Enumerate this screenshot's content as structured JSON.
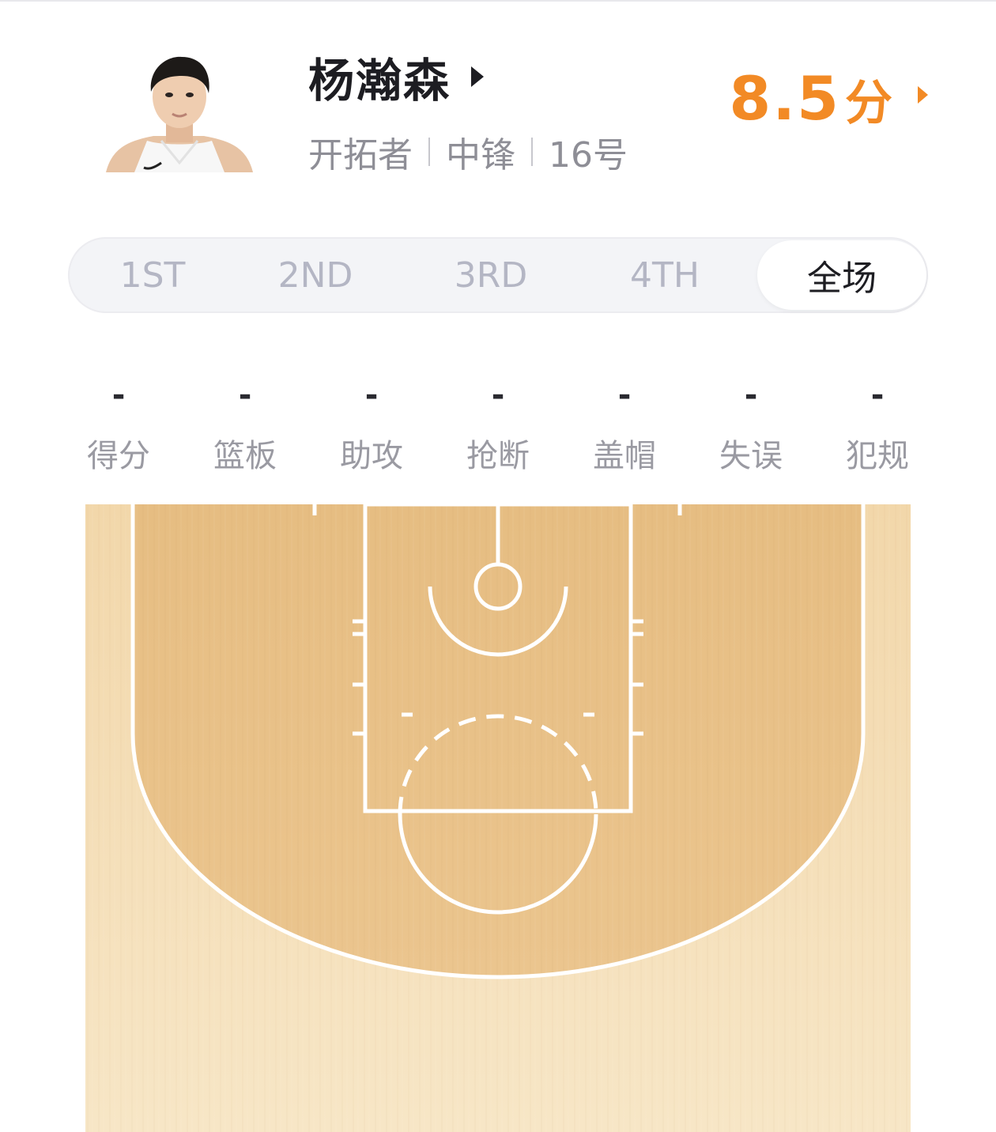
{
  "player": {
    "name": "杨瀚森",
    "team": "开拓者",
    "position": "中锋",
    "number": "16号"
  },
  "rating": {
    "value": "8.5",
    "unit": "分"
  },
  "tabs": [
    {
      "label": "1ST",
      "active": false
    },
    {
      "label": "2ND",
      "active": false
    },
    {
      "label": "3RD",
      "active": false
    },
    {
      "label": "4TH",
      "active": false
    },
    {
      "label": "全场",
      "active": true
    }
  ],
  "stats": [
    {
      "value": "-",
      "label": "得分"
    },
    {
      "value": "-",
      "label": "篮板"
    },
    {
      "value": "-",
      "label": "助攻"
    },
    {
      "value": "-",
      "label": "抢断"
    },
    {
      "value": "-",
      "label": "盖帽"
    },
    {
      "value": "-",
      "label": "失误"
    },
    {
      "value": "-",
      "label": "犯规"
    }
  ],
  "colors": {
    "accent": "#f28a25",
    "court_wood_light": "#f6e2bf",
    "court_wood_dark": "#e9c489",
    "court_lines": "#ffffff"
  }
}
